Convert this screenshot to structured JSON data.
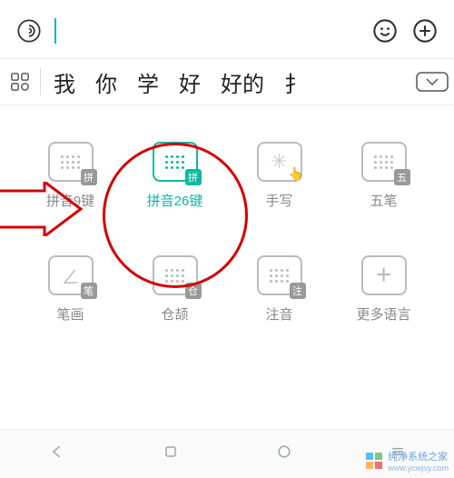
{
  "topbar": {
    "voice": "voice-icon",
    "emoji": "emoji-icon",
    "add": "add-icon",
    "input_value": ""
  },
  "candidates": [
    "我",
    "你",
    "学",
    "好",
    "好的",
    "扌"
  ],
  "layouts": {
    "row1": [
      {
        "label": "拼音9键",
        "badge": "拼",
        "active": false,
        "type": "keys"
      },
      {
        "label": "拼音26键",
        "badge": "拼",
        "active": true,
        "type": "keys"
      },
      {
        "label": "手写",
        "badge": "",
        "active": false,
        "type": "hand"
      },
      {
        "label": "五笔",
        "badge": "五",
        "active": false,
        "type": "keys"
      }
    ],
    "row2": [
      {
        "label": "笔画",
        "badge": "笔",
        "active": false,
        "type": "glyph"
      },
      {
        "label": "仓颉",
        "badge": "仓",
        "active": false,
        "type": "keys"
      },
      {
        "label": "注音",
        "badge": "注",
        "active": false,
        "type": "keys"
      },
      {
        "label": "更多语言",
        "badge": "",
        "active": false,
        "type": "plus"
      }
    ]
  },
  "watermark": {
    "site": "纯净系统之家",
    "url": "www.ycwjsy.com"
  }
}
